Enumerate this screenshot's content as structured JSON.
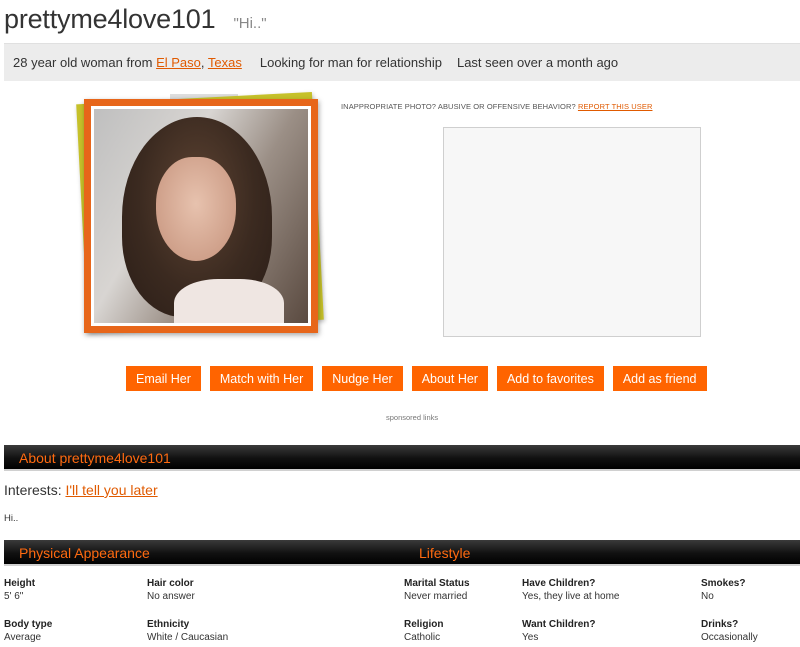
{
  "profile": {
    "username": "prettyme4love101",
    "tagline": "\"Hi..\""
  },
  "info": {
    "intro": "28 year old woman from ",
    "city": "El Paso",
    "comma": ", ",
    "state": "Texas",
    "looking": "Looking for man for relationship",
    "last_seen": "Last seen over a month ago"
  },
  "report": {
    "text": "INAPPROPRIATE PHOTO? ABUSIVE OR OFFENSIVE BEHAVIOR? ",
    "link": "REPORT THIS USER"
  },
  "actions": {
    "email": "Email Her",
    "match": "Match with Her",
    "nudge": "Nudge Her",
    "about": "About Her",
    "favorites": "Add to favorites",
    "friend": "Add as friend"
  },
  "sponsored": "sponsored links",
  "about_section": {
    "title": "About prettyme4love101",
    "interests_label": "Interests: ",
    "interests_value": "I'll tell you later",
    "text": "Hi.."
  },
  "sections": {
    "physical": "Physical Appearance",
    "lifestyle": "Lifestyle"
  },
  "attributes": {
    "height": {
      "label": "Height",
      "value": "5' 6\""
    },
    "hair": {
      "label": "Hair color",
      "value": "No answer"
    },
    "marital": {
      "label": "Marital Status",
      "value": "Never married"
    },
    "children": {
      "label": "Have Children?",
      "value": "Yes, they live at home"
    },
    "smokes": {
      "label": "Smokes?",
      "value": "No"
    },
    "body": {
      "label": "Body type",
      "value": "Average"
    },
    "ethnicity": {
      "label": "Ethnicity",
      "value": "White / Caucasian"
    },
    "religion": {
      "label": "Religion",
      "value": "Catholic"
    },
    "want_children": {
      "label": "Want Children?",
      "value": "Yes"
    },
    "drinks": {
      "label": "Drinks?",
      "value": "Occasionally"
    }
  },
  "colors": {
    "accent": "#ff6400",
    "link": "#e05a00",
    "frame": "#e7661a",
    "frame_back": "#c6c12a"
  }
}
